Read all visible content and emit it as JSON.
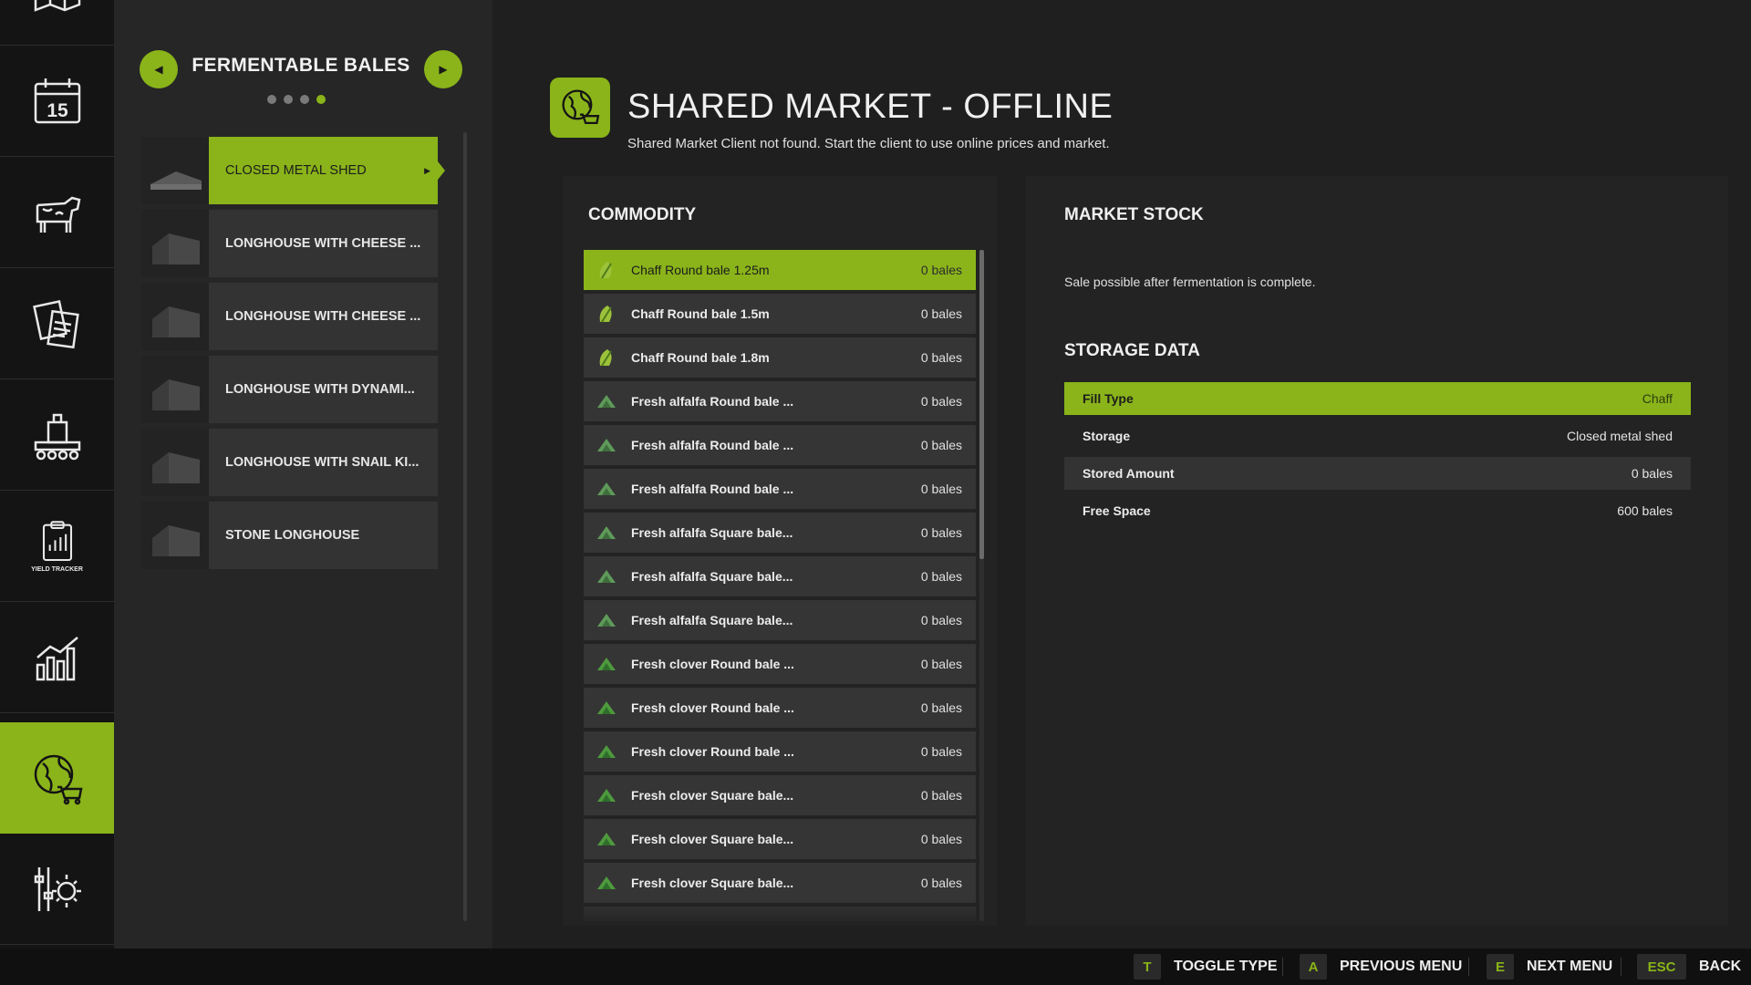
{
  "sidebar": {
    "active_index": 6,
    "items": [
      {
        "name": "map",
        "icon": "map-icon"
      },
      {
        "name": "calendar",
        "icon": "calendar-icon",
        "label": "15"
      },
      {
        "name": "animals",
        "icon": "cow-icon"
      },
      {
        "name": "contracts",
        "icon": "documents-icon"
      },
      {
        "name": "production",
        "icon": "factory-icon"
      },
      {
        "name": "yield-tracker",
        "icon": "yield-tracker-icon",
        "label": "YIELD TRACKER"
      },
      {
        "name": "statistics",
        "icon": "bar-chart-icon"
      },
      {
        "name": "shared-market",
        "icon": "globe-cart-icon"
      },
      {
        "name": "settings",
        "icon": "settings-sliders-icon"
      }
    ]
  },
  "category": {
    "title": "FERMENTABLE BALES",
    "page_count": 4,
    "current_page": 4,
    "prev_icon": "arrow-left-icon",
    "next_icon": "arrow-right-icon"
  },
  "buildings": [
    {
      "label": "CLOSED METAL SHED",
      "active": true
    },
    {
      "label": "LONGHOUSE WITH CHEESE ...",
      "active": false
    },
    {
      "label": "LONGHOUSE WITH CHEESE ...",
      "active": false
    },
    {
      "label": "LONGHOUSE WITH DYNAMI...",
      "active": false
    },
    {
      "label": "LONGHOUSE WITH SNAIL KI...",
      "active": false
    },
    {
      "label": "STONE LONGHOUSE",
      "active": false
    }
  ],
  "header": {
    "title": "SHARED MARKET - OFFLINE",
    "subtitle": "Shared Market Client not found. Start the client to use online prices and market.",
    "icon": "globe-cart-icon"
  },
  "commodity": {
    "title": "COMMODITY",
    "scroll_fraction": 0.46,
    "rows": [
      {
        "name": "Chaff Round bale 1.25m",
        "amount": "0 bales",
        "icon": "chaff-icon",
        "active": true
      },
      {
        "name": "Chaff Round bale 1.5m",
        "amount": "0 bales",
        "icon": "chaff-icon",
        "active": false
      },
      {
        "name": "Chaff Round bale 1.8m",
        "amount": "0 bales",
        "icon": "chaff-icon",
        "active": false
      },
      {
        "name": "Fresh alfalfa Round bale ...",
        "amount": "0 bales",
        "icon": "alfalfa-icon",
        "active": false
      },
      {
        "name": "Fresh alfalfa Round bale ...",
        "amount": "0 bales",
        "icon": "alfalfa-icon",
        "active": false
      },
      {
        "name": "Fresh alfalfa Round bale ...",
        "amount": "0 bales",
        "icon": "alfalfa-icon",
        "active": false
      },
      {
        "name": "Fresh alfalfa Square bale...",
        "amount": "0 bales",
        "icon": "alfalfa-icon",
        "active": false
      },
      {
        "name": "Fresh alfalfa Square bale...",
        "amount": "0 bales",
        "icon": "alfalfa-icon",
        "active": false
      },
      {
        "name": "Fresh alfalfa Square bale...",
        "amount": "0 bales",
        "icon": "alfalfa-icon",
        "active": false
      },
      {
        "name": "Fresh clover Round bale ...",
        "amount": "0 bales",
        "icon": "clover-icon",
        "active": false
      },
      {
        "name": "Fresh clover Round bale ...",
        "amount": "0 bales",
        "icon": "clover-icon",
        "active": false
      },
      {
        "name": "Fresh clover Round bale ...",
        "amount": "0 bales",
        "icon": "clover-icon",
        "active": false
      },
      {
        "name": "Fresh clover Square bale...",
        "amount": "0 bales",
        "icon": "clover-icon",
        "active": false
      },
      {
        "name": "Fresh clover Square bale...",
        "amount": "0 bales",
        "icon": "clover-icon",
        "active": false
      },
      {
        "name": "Fresh clover Square bale...",
        "amount": "0 bales",
        "icon": "clover-icon",
        "active": false
      }
    ]
  },
  "market_stock": {
    "title": "MARKET STOCK",
    "message": "Sale possible after fermentation is complete."
  },
  "storage": {
    "title": "STORAGE DATA",
    "rows": [
      {
        "key": "Fill Type",
        "value": "Chaff",
        "style": "active"
      },
      {
        "key": "Storage",
        "value": "Closed metal shed",
        "style": "plain"
      },
      {
        "key": "Stored Amount",
        "value": "0 bales",
        "style": "alt"
      },
      {
        "key": "Free Space",
        "value": "600 bales",
        "style": "plain"
      }
    ]
  },
  "hints": [
    {
      "key": "T",
      "label": "TOGGLE TYPE"
    },
    {
      "key": "A",
      "label": "PREVIOUS MENU"
    },
    {
      "key": "E",
      "label": "NEXT MENU"
    },
    {
      "key": "ESC",
      "label": "BACK"
    }
  ],
  "colors": {
    "accent": "#8ab41a",
    "background": "#1f1f1f",
    "panel": "#232323",
    "row": "#353535",
    "rail": "#141414"
  }
}
